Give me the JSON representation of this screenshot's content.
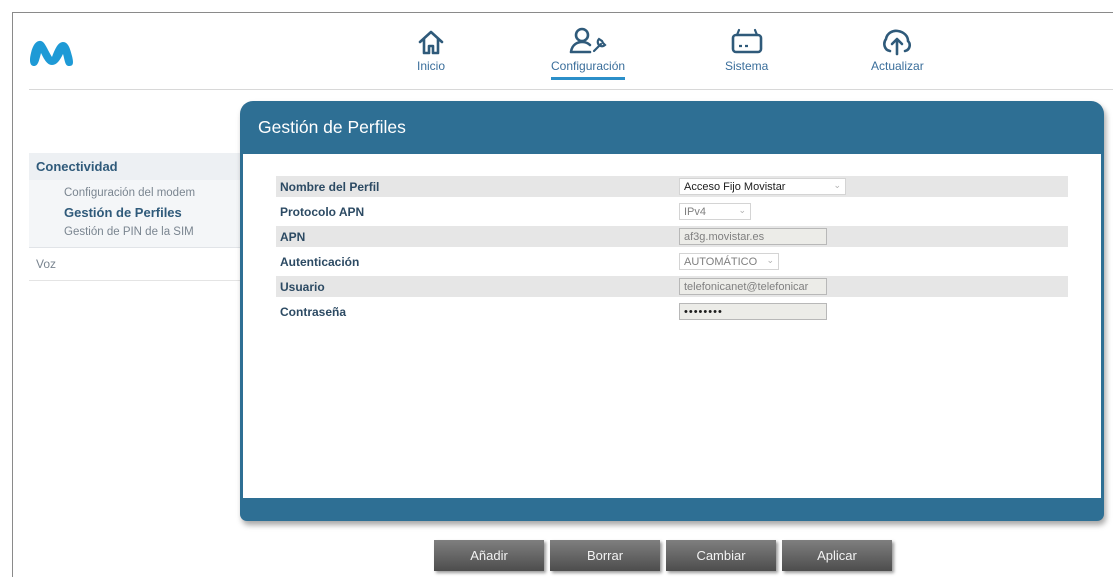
{
  "nav": {
    "inicio": "Inicio",
    "configuracion": "Configuración",
    "sistema": "Sistema",
    "actualizar": "Actualizar"
  },
  "sidebar": {
    "section": "Conectividad",
    "items": [
      {
        "label": "Configuración del modem"
      },
      {
        "label": "Gestión de Perfiles"
      },
      {
        "label": "Gestión de PIN de la SIM"
      }
    ],
    "voz": "Voz"
  },
  "panel": {
    "title": "Gestión de Perfiles",
    "fields": {
      "nombre": {
        "label": "Nombre del Perfil",
        "value": "Acceso Fijo Movistar"
      },
      "protocolo": {
        "label": "Protocolo APN",
        "value": "IPv4"
      },
      "apn": {
        "label": "APN",
        "value": "af3g.movistar.es"
      },
      "autenticacion": {
        "label": "Autenticación",
        "value": "AUTOMÁTICO"
      },
      "usuario": {
        "label": "Usuario",
        "value": "telefonicanet@telefonicar"
      },
      "contrasena": {
        "label": "Contraseña",
        "value": "••••••••"
      }
    }
  },
  "buttons": {
    "anadir": "Añadir",
    "borrar": "Borrar",
    "cambiar": "Cambiar",
    "aplicar": "Aplicar"
  },
  "colors": {
    "brand_blue": "#1e9ad6",
    "panel_header": "#2e6f94",
    "nav_text": "#3a6e9b"
  }
}
